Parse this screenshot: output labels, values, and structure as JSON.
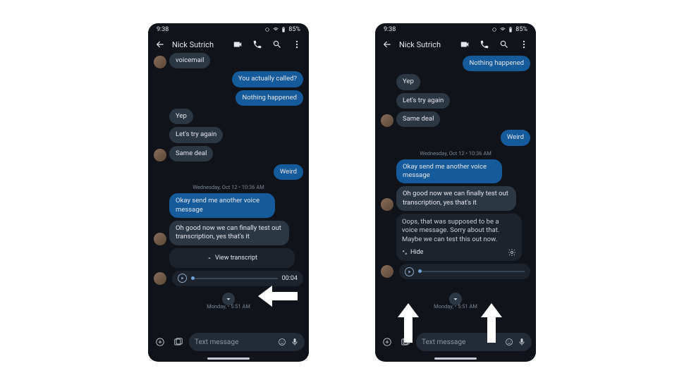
{
  "status": {
    "time": "9:38",
    "battery": "85%"
  },
  "header": {
    "contact_name": "Nick Sutrich"
  },
  "left": {
    "msgs": {
      "voicemail": "voicemail",
      "you_called": "You actually called?",
      "nothing_happened": "Nothing happened",
      "yep": "Yep",
      "try_again": "Let's try again",
      "same_deal": "Same deal",
      "weird": "Weird",
      "ts1": "Wednesday, Oct 12 • 10:36 AM",
      "send_voice": "Okay send me another voice message",
      "test_out": "Oh good now we can finally test out transcription, yes that's it",
      "view_transcript": "View transcript",
      "voice_time": "00:04",
      "bottom_ts": "Monday, • 5:51 AM"
    }
  },
  "right": {
    "msgs": {
      "nothing_happened": "Nothing happened",
      "yep": "Yep",
      "try_again": "Let's try again",
      "same_deal": "Same deal",
      "weird": "Weird",
      "ts1": "Wednesday, Oct 12 • 10:36 AM",
      "send_voice": "Okay send me another voice message",
      "test_out": "Oh good now we can finally test out transcription, yes that's it",
      "transcript_body": "Oops, that was supposed to be a voice message. Sorry about that. Maybe we can test this out now.",
      "hide": "Hide",
      "bottom_ts": "Monday, • 5:51 AM"
    }
  },
  "composer": {
    "placeholder": "Text message"
  }
}
